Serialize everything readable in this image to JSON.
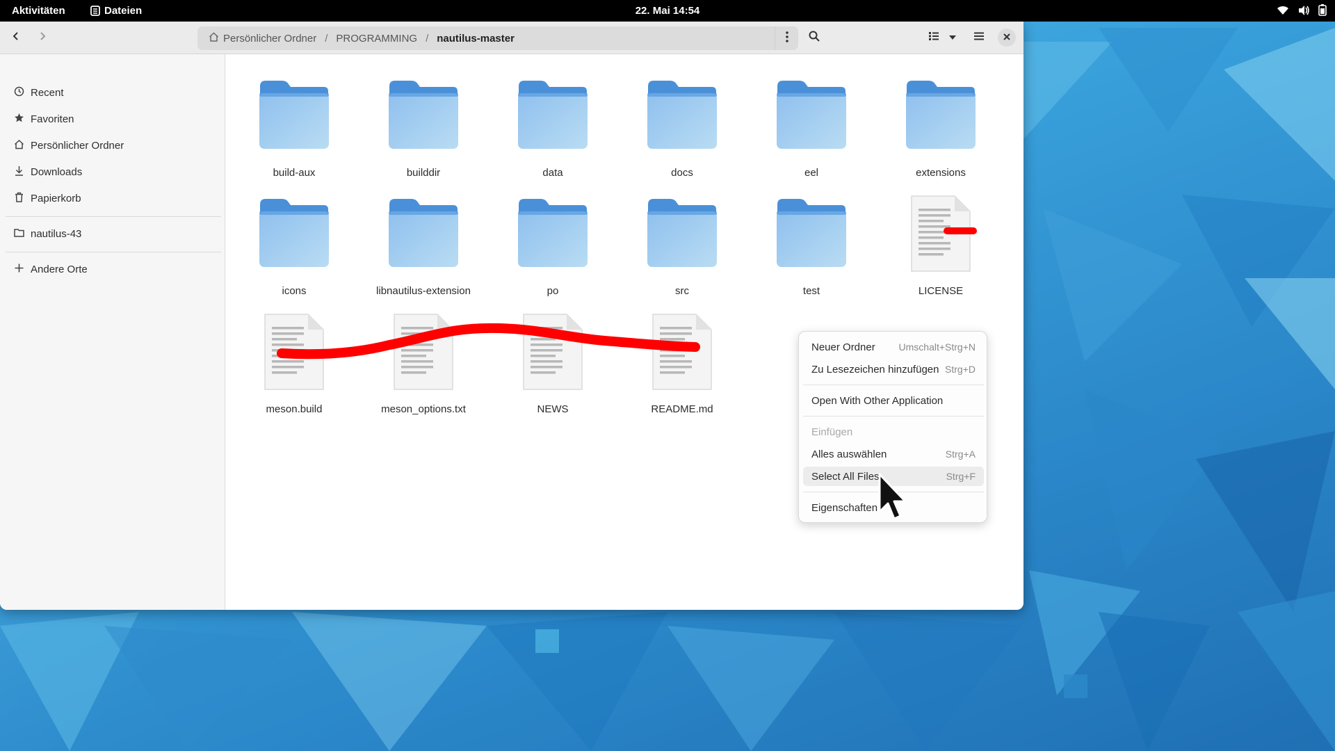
{
  "topbar": {
    "activities": "Aktivitäten",
    "app_name": "Dateien",
    "clock": "22. Mai  14:54",
    "status_icons": [
      "wifi-icon",
      "volume-icon",
      "battery-icon"
    ]
  },
  "headerbar": {
    "path": [
      "Persönlicher Ordner",
      "PROGRAMMING",
      "nautilus-master"
    ]
  },
  "sidebar": {
    "items": [
      {
        "label": "Recent",
        "icon": "clock-icon"
      },
      {
        "label": "Favoriten",
        "icon": "star-icon"
      },
      {
        "label": "Persönlicher Ordner",
        "icon": "home-icon"
      },
      {
        "label": "Downloads",
        "icon": "download-icon"
      },
      {
        "label": "Papierkorb",
        "icon": "trash-icon"
      }
    ],
    "bookmarks": [
      {
        "label": "nautilus-43",
        "icon": "folder-icon"
      }
    ],
    "other": {
      "label": "Andere Orte",
      "icon": "plus-icon"
    }
  },
  "files": [
    {
      "name": "build-aux",
      "type": "folder"
    },
    {
      "name": "builddir",
      "type": "folder"
    },
    {
      "name": "data",
      "type": "folder"
    },
    {
      "name": "docs",
      "type": "folder"
    },
    {
      "name": "eel",
      "type": "folder"
    },
    {
      "name": "extensions",
      "type": "folder"
    },
    {
      "name": "icons",
      "type": "folder"
    },
    {
      "name": "libnautilus-extension",
      "type": "folder"
    },
    {
      "name": "po",
      "type": "folder"
    },
    {
      "name": "src",
      "type": "folder"
    },
    {
      "name": "test",
      "type": "folder"
    },
    {
      "name": "LICENSE",
      "type": "text"
    },
    {
      "name": "meson.build",
      "type": "text"
    },
    {
      "name": "meson_options.txt",
      "type": "text"
    },
    {
      "name": "NEWS",
      "type": "text"
    },
    {
      "name": "README.md",
      "type": "text"
    }
  ],
  "context_menu": {
    "items": [
      {
        "label": "Neuer Ordner",
        "accel": "Umschalt+Strg+N"
      },
      {
        "label": "Zu Lesezeichen hinzufügen",
        "accel": "Strg+D"
      },
      {
        "label": "Open With Other Application",
        "accel": ""
      },
      {
        "label": "Einfügen",
        "accel": "",
        "disabled": true
      },
      {
        "label": "Alles auswählen",
        "accel": "Strg+A"
      },
      {
        "label": "Select All Files",
        "accel": "Strg+F",
        "highlighted": true
      },
      {
        "label": "Eigenschaften",
        "accel": ""
      }
    ]
  },
  "colors": {
    "folder_blue": "#4a90d9",
    "folder_light": "#a8cff0",
    "annotation_red": "#ff0000"
  }
}
